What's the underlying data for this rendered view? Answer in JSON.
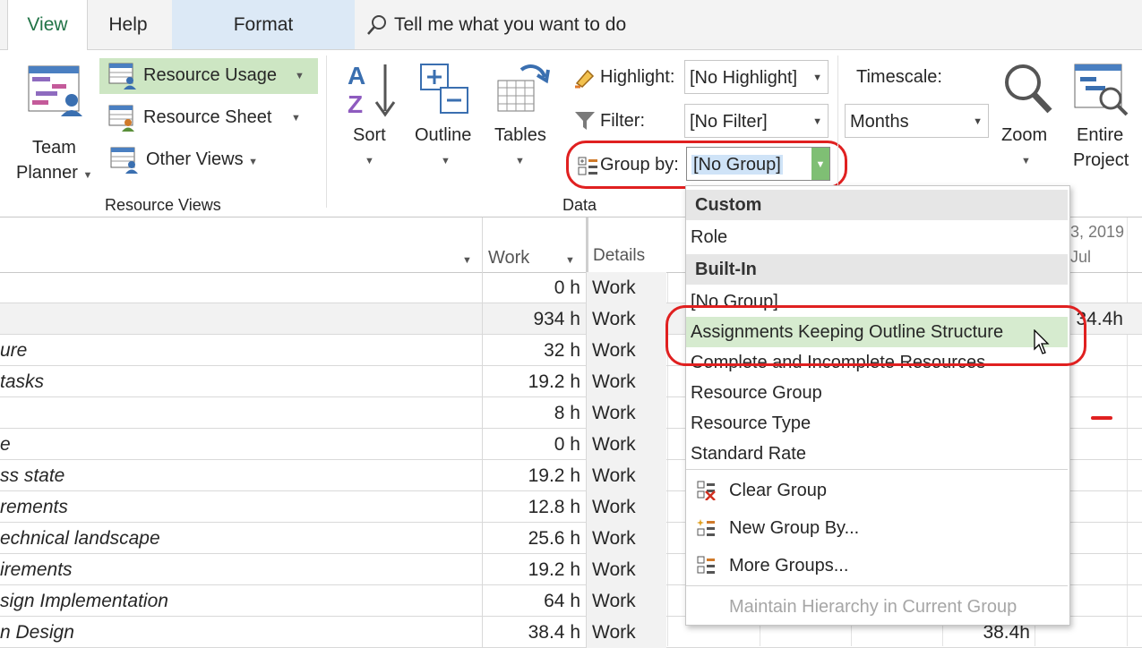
{
  "tabs": {
    "view": "View",
    "help": "Help",
    "format": "Format"
  },
  "tellme": "Tell me what you want to do",
  "ribbon": {
    "team_planner": [
      "Team",
      "Planner"
    ],
    "resource_usage": "Resource Usage",
    "resource_sheet": "Resource Sheet",
    "other_views": "Other Views",
    "group_resource_views": "Resource Views",
    "sort": "Sort",
    "outline": "Outline",
    "tables": "Tables",
    "highlight_label": "Highlight:",
    "highlight_value": "[No Highlight]",
    "filter_label": "Filter:",
    "filter_value": "[No Filter]",
    "groupby_label": "Group by:",
    "groupby_value": "[No Group]",
    "group_data": "Data",
    "timescale_label": "Timescale:",
    "timescale_value": "Months",
    "zoom": "Zoom",
    "entire_project": [
      "Entire",
      "Project"
    ]
  },
  "grid": {
    "headers": {
      "work": "Work",
      "details": "Details",
      "date": "3, 2019",
      "month": "Jul"
    },
    "rows": [
      {
        "name": "",
        "work": "0 h",
        "details": "Work",
        "t": ""
      },
      {
        "name": "",
        "work": "934 h",
        "details": "Work",
        "t": "34.4h"
      },
      {
        "name": "ure",
        "work": "32 h",
        "details": "Work",
        "t": ""
      },
      {
        "name": "tasks",
        "work": "19.2 h",
        "details": "Work",
        "t": ""
      },
      {
        "name": "",
        "work": "8 h",
        "details": "Work",
        "t": ""
      },
      {
        "name": "e",
        "work": "0 h",
        "details": "Work",
        "t": ""
      },
      {
        "name": "ss state",
        "work": "19.2 h",
        "details": "Work",
        "t": ""
      },
      {
        "name": "rements",
        "work": "12.8 h",
        "details": "Work",
        "t": ""
      },
      {
        "name": "echnical landscape",
        "work": "25.6 h",
        "details": "Work",
        "t": ""
      },
      {
        "name": "irements",
        "work": "19.2 h",
        "details": "Work",
        "t": ""
      },
      {
        "name": "sign Implementation",
        "work": "64 h",
        "details": "Work",
        "t": ""
      },
      {
        "name": "n Design",
        "work": "38.4 h",
        "details": "Work",
        "t": "38.4h"
      }
    ]
  },
  "group_dropdown": {
    "custom_header": "Custom",
    "custom_items": [
      "Role"
    ],
    "builtin_header": "Built-In",
    "builtin_items": [
      "[No Group]",
      "Assignments Keeping Outline Structure",
      "Complete and Incomplete Resources",
      "Resource Group",
      "Resource Type",
      "Standard Rate"
    ],
    "commands": {
      "clear": "Clear Group",
      "new": "New Group By...",
      "more": "More Groups...",
      "maintain": "Maintain Hierarchy in Current Group"
    }
  },
  "colors": {
    "accent_green": "#217346",
    "selected_green": "#d6ebcf",
    "highlight_ring": "#e02020",
    "format_tab": "#dce9f6"
  }
}
